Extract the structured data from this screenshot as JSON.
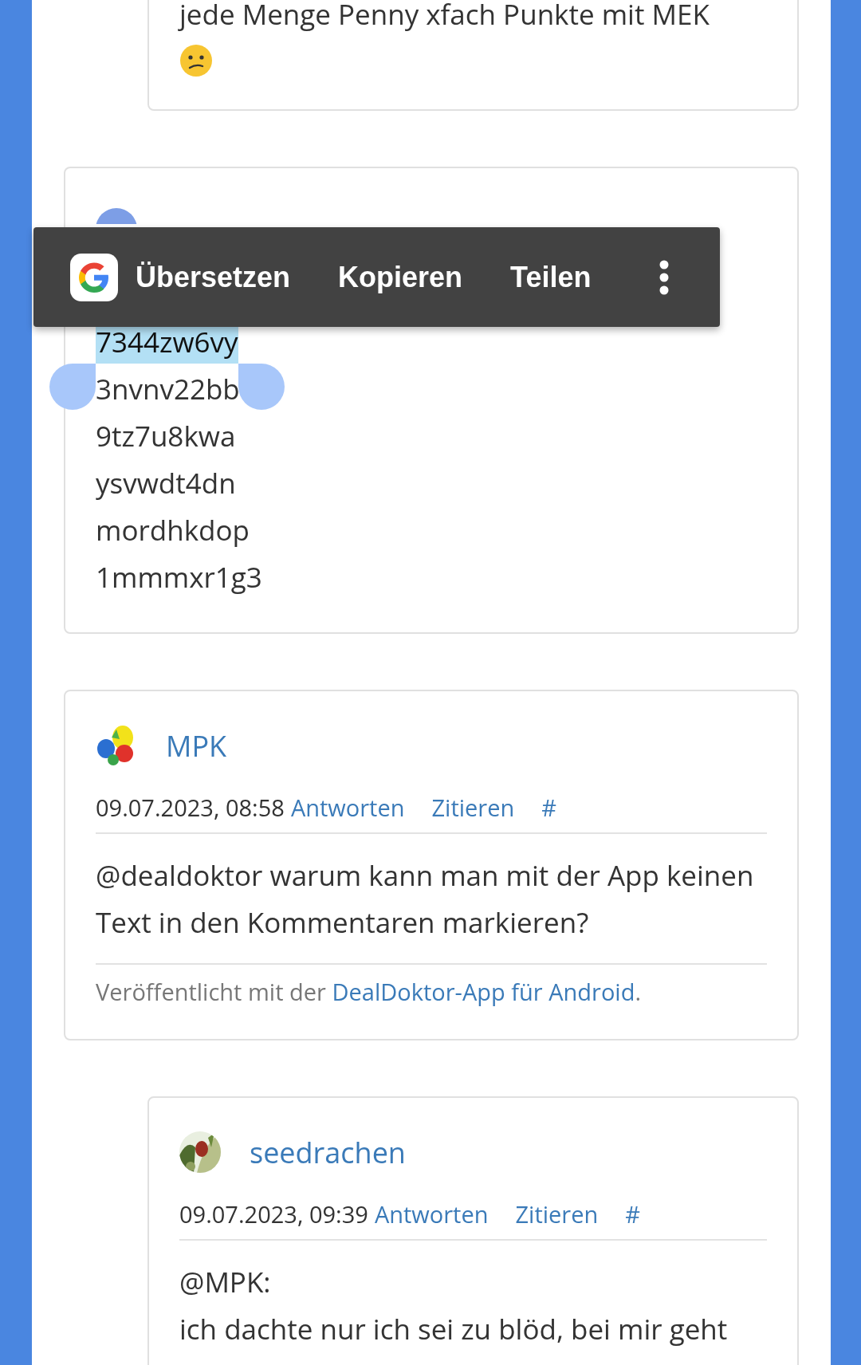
{
  "comments": [
    {
      "kind": "reply",
      "body": [
        "jede Menge Penny xfach Punkte mit MEK"
      ],
      "emoji": true
    },
    {
      "kind": "comment",
      "avatar": {
        "kind": "circle"
      },
      "codes": [
        {
          "text": "7344zw6vy",
          "selected": true
        },
        {
          "text": "3nvnv22bb",
          "selected": false
        },
        {
          "text": "9tz7u8kwa",
          "selected": false
        },
        {
          "text": "ysvwdt4dn",
          "selected": false
        },
        {
          "text": "mordhkdop",
          "selected": false
        },
        {
          "text": "1mmmxr1g3",
          "selected": false
        }
      ]
    },
    {
      "kind": "comment",
      "avatar": {
        "kind": "balloons"
      },
      "author": "MPK",
      "date": "09.07.2023, 08:58",
      "actions": [
        "Antworten",
        "Zitieren",
        "#"
      ],
      "body": [
        "@dealdoktor warum kann man mit der App keinen Text in den Kommentaren markieren?"
      ],
      "footer": {
        "prefix": "Veröffentlicht mit der ",
        "link": "DealDoktor-App für Android",
        "suffix": "."
      }
    },
    {
      "kind": "reply",
      "avatar": {
        "kind": "picture"
      },
      "author": "seedrachen",
      "date": "09.07.2023, 09:39",
      "actions": [
        "Antworten",
        "Zitieren",
        "#"
      ],
      "body": [
        "@MPK:",
        "ich dachte nur ich sei zu blöd, bei mir geht"
      ]
    }
  ],
  "popup": {
    "actions": [
      "Übersetzen",
      "Kopieren",
      "Teilen"
    ]
  }
}
